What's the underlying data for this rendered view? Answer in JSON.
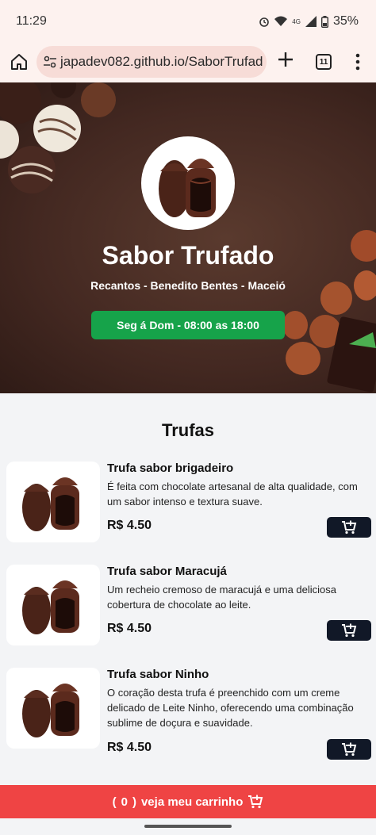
{
  "status_bar": {
    "time": "11:29",
    "network": "4G",
    "battery": "35%"
  },
  "browser": {
    "url": "japadev082.github.io/SaborTrufad",
    "tab_count": "11"
  },
  "hero": {
    "title": "Sabor Trufado",
    "subtitle": "Recantos - Benedito Bentes - Maceió",
    "hours": "Seg á Dom - 08:00 as 18:00"
  },
  "section": {
    "title": "Trufas"
  },
  "products": [
    {
      "name": "Trufa sabor brigadeiro",
      "description": "É feita com chocolate artesanal de alta qualidade, com um sabor intenso e textura suave.",
      "price": "R$ 4.50"
    },
    {
      "name": "Trufa sabor Maracujá",
      "description": "Um recheio cremoso de maracujá e uma deliciosa cobertura de chocolate ao leite.",
      "price": "R$ 4.50"
    },
    {
      "name": "Trufa sabor Ninho",
      "description": "O coração desta trufa é preenchido com um creme delicado de Leite Ninho, oferecendo uma combinação sublime de doçura e suavidade.",
      "price": "R$ 4.50"
    }
  ],
  "cart": {
    "count": "0",
    "label": "veja meu carrinho"
  },
  "colors": {
    "accent_green": "#16a34a",
    "cart_red": "#ef4444",
    "button_dark": "#111827"
  }
}
